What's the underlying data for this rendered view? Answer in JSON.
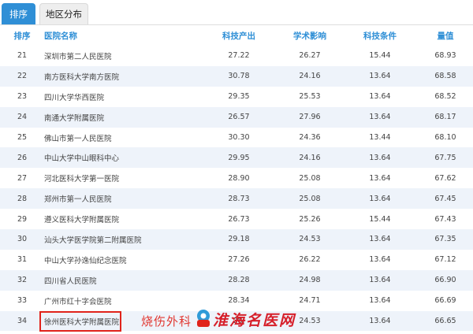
{
  "tabs": [
    {
      "label": "排序",
      "active": true
    },
    {
      "label": "地区分布",
      "active": false
    }
  ],
  "table": {
    "headers": {
      "rank": "排序",
      "name": "医院名称",
      "output": "科技产出",
      "influence": "学术影响",
      "conditions": "科技条件",
      "score": "量值"
    },
    "rows": [
      {
        "rank": "21",
        "name": "深圳市第二人民医院",
        "output": "27.22",
        "influence": "26.27",
        "conditions": "15.44",
        "score": "68.93"
      },
      {
        "rank": "22",
        "name": "南方医科大学南方医院",
        "output": "30.78",
        "influence": "24.16",
        "conditions": "13.64",
        "score": "68.58"
      },
      {
        "rank": "23",
        "name": "四川大学华西医院",
        "output": "29.35",
        "influence": "25.53",
        "conditions": "13.64",
        "score": "68.52"
      },
      {
        "rank": "24",
        "name": "南通大学附属医院",
        "output": "26.57",
        "influence": "27.96",
        "conditions": "13.64",
        "score": "68.17"
      },
      {
        "rank": "25",
        "name": "佛山市第一人民医院",
        "output": "30.30",
        "influence": "24.36",
        "conditions": "13.44",
        "score": "68.10"
      },
      {
        "rank": "26",
        "name": "中山大学中山眼科中心",
        "output": "29.95",
        "influence": "24.16",
        "conditions": "13.64",
        "score": "67.75"
      },
      {
        "rank": "27",
        "name": "河北医科大学第一医院",
        "output": "28.90",
        "influence": "25.08",
        "conditions": "13.64",
        "score": "67.62"
      },
      {
        "rank": "28",
        "name": "郑州市第一人民医院",
        "output": "28.73",
        "influence": "25.08",
        "conditions": "13.64",
        "score": "67.45"
      },
      {
        "rank": "29",
        "name": "遵义医科大学附属医院",
        "output": "26.73",
        "influence": "25.26",
        "conditions": "15.44",
        "score": "67.43"
      },
      {
        "rank": "30",
        "name": "汕头大学医学院第二附属医院",
        "output": "29.18",
        "influence": "24.53",
        "conditions": "13.64",
        "score": "67.35"
      },
      {
        "rank": "31",
        "name": "中山大学孙逸仙纪念医院",
        "output": "27.26",
        "influence": "26.22",
        "conditions": "13.64",
        "score": "67.12"
      },
      {
        "rank": "32",
        "name": "四川省人民医院",
        "output": "28.28",
        "influence": "24.98",
        "conditions": "13.64",
        "score": "66.90"
      },
      {
        "rank": "33",
        "name": "广州市红十字会医院",
        "output": "28.34",
        "influence": "24.71",
        "conditions": "13.64",
        "score": "66.69"
      },
      {
        "rank": "34",
        "name": "徐州医科大学附属医院",
        "output": "28.",
        "influence": "24.53",
        "conditions": "13.64",
        "score": "66.65"
      }
    ]
  },
  "watermark": {
    "text1": "烧伤外科",
    "text2": "淮海名医网"
  },
  "colors": {
    "accent": "#2f8fd6",
    "stripe": "#eef3fa",
    "highlight": "#e0231b"
  }
}
